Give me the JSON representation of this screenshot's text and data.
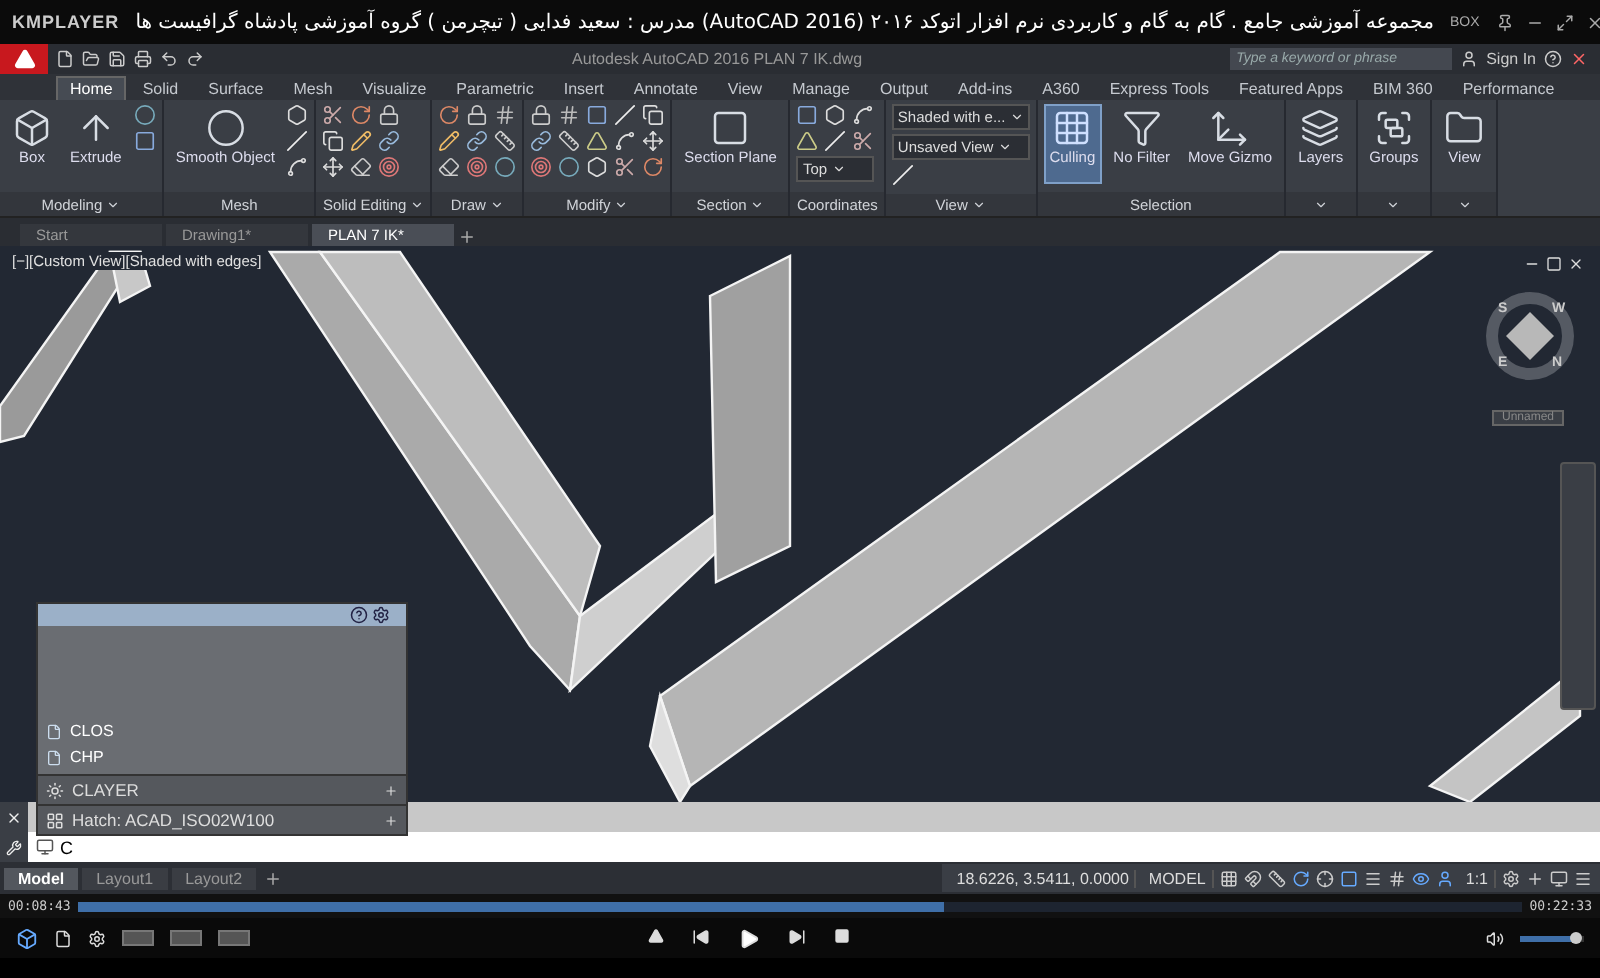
{
  "player": {
    "brand": "KMPLAYER",
    "title": "مجموعه آموزشی جامع . گام به گام و کاربردی نرم افزار  اتوکد ۲۰۱۶ (AutoCAD 2016)  مدرس : سعید فدایی ( تیچرمن ) گروه آموزشی پادشاه گرافیست ها",
    "box_label": "BOX"
  },
  "autocad": {
    "doc_title": "Autodesk AutoCAD 2016    PLAN 7 IK.dwg",
    "search_placeholder": "Type a keyword or phrase",
    "sign_in": "Sign In",
    "ribbon_tabs": [
      {
        "label": "Home",
        "selected": true
      },
      {
        "label": "Solid",
        "selected": false
      },
      {
        "label": "Surface",
        "selected": false
      },
      {
        "label": "Mesh",
        "selected": false
      },
      {
        "label": "Visualize",
        "selected": false
      },
      {
        "label": "Parametric",
        "selected": false
      },
      {
        "label": "Insert",
        "selected": false
      },
      {
        "label": "Annotate",
        "selected": false
      },
      {
        "label": "View",
        "selected": false
      },
      {
        "label": "Manage",
        "selected": false
      },
      {
        "label": "Output",
        "selected": false
      },
      {
        "label": "Add-ins",
        "selected": false
      },
      {
        "label": "A360",
        "selected": false
      },
      {
        "label": "Express Tools",
        "selected": false
      },
      {
        "label": "Featured Apps",
        "selected": false
      },
      {
        "label": "BIM 360",
        "selected": false
      },
      {
        "label": "Performance",
        "selected": false
      }
    ],
    "panels": [
      {
        "label": "Modeling",
        "menu": true,
        "tools": [
          {
            "kind": "large",
            "label": "Box",
            "active": false
          },
          {
            "kind": "large",
            "label": "Extrude",
            "active": false
          },
          {
            "kind": "small"
          },
          {
            "kind": "small"
          }
        ]
      },
      {
        "label": "Mesh",
        "menu": false,
        "tools": [
          {
            "kind": "large",
            "label": "Smooth Object",
            "active": false
          },
          {
            "kind": "small"
          },
          {
            "kind": "small"
          },
          {
            "kind": "small"
          }
        ]
      },
      {
        "label": "Solid Editing",
        "menu": true,
        "tools": [
          {
            "kind": "small"
          },
          {
            "kind": "small"
          },
          {
            "kind": "small"
          },
          {
            "kind": "small"
          },
          {
            "kind": "small"
          },
          {
            "kind": "small"
          },
          {
            "kind": "small"
          },
          {
            "kind": "small"
          },
          {
            "kind": "small"
          }
        ]
      },
      {
        "label": "Draw",
        "menu": true,
        "tools": [
          {
            "kind": "small"
          },
          {
            "kind": "small"
          },
          {
            "kind": "small"
          },
          {
            "kind": "small"
          },
          {
            "kind": "small"
          },
          {
            "kind": "small"
          },
          {
            "kind": "small"
          },
          {
            "kind": "small"
          },
          {
            "kind": "small"
          }
        ]
      },
      {
        "label": "Modify",
        "menu": true,
        "tools": [
          {
            "kind": "small"
          },
          {
            "kind": "small"
          },
          {
            "kind": "small"
          },
          {
            "kind": "small"
          },
          {
            "kind": "small"
          },
          {
            "kind": "small"
          },
          {
            "kind": "small"
          },
          {
            "kind": "small"
          },
          {
            "kind": "small"
          },
          {
            "kind": "small"
          },
          {
            "kind": "small"
          },
          {
            "kind": "small"
          },
          {
            "kind": "small"
          },
          {
            "kind": "small"
          },
          {
            "kind": "small"
          }
        ]
      },
      {
        "label": "Section",
        "menu": true,
        "tools": [
          {
            "kind": "large",
            "label": "Section Plane",
            "active": false
          }
        ]
      },
      {
        "label": "Coordinates",
        "menu": false,
        "tools": [
          {
            "kind": "small"
          },
          {
            "kind": "small"
          },
          {
            "kind": "small"
          },
          {
            "kind": "small"
          },
          {
            "kind": "small"
          },
          {
            "kind": "small"
          },
          {
            "kind": "combo",
            "label": "Top"
          }
        ]
      },
      {
        "label": "View",
        "menu": true,
        "tools": [
          {
            "kind": "combo",
            "label": "Shaded with e..."
          },
          {
            "kind": "combo",
            "label": "Unsaved View"
          },
          {
            "kind": "small"
          }
        ]
      },
      {
        "label": "Selection",
        "menu": false,
        "tools": [
          {
            "kind": "large",
            "label": "Culling",
            "active": true
          },
          {
            "kind": "large",
            "label": "No Filter",
            "active": false
          },
          {
            "kind": "large",
            "label": "Move Gizmo",
            "active": false
          }
        ]
      },
      {
        "menu": true,
        "tools": [
          {
            "kind": "large",
            "label": "Layers",
            "active": false
          }
        ]
      },
      {
        "menu": true,
        "tools": [
          {
            "kind": "large",
            "label": "Groups",
            "active": false
          }
        ]
      },
      {
        "menu": true,
        "tools": [
          {
            "kind": "large",
            "label": "View",
            "active": false
          }
        ]
      }
    ],
    "file_tabs": [
      {
        "label": "Start",
        "selected": false
      },
      {
        "label": "Drawing1*",
        "selected": false
      },
      {
        "label": "PLAN 7 IK*",
        "selected": true
      }
    ],
    "viewport_label": "[−][Custom View][Shaded with edges]",
    "compass": [
      "S",
      "W",
      "E",
      "N"
    ],
    "view_name": "Unnamed",
    "history": [
      "CLOS",
      "CHP"
    ],
    "palette_rows": [
      "CLAYER",
      "Hatch: ACAD_ISO02W100"
    ],
    "command_input": "C",
    "layout_tabs": [
      {
        "label": "Model",
        "selected": true
      },
      {
        "label": "Layout1",
        "selected": false
      },
      {
        "label": "Layout2",
        "selected": false
      }
    ],
    "status": {
      "coords": "18.6226, 3.5411, 0.0000",
      "space": "MODEL",
      "scale": "1:1"
    }
  },
  "playback": {
    "current_time": "00:08:43",
    "total_time": "00:22:33",
    "level": 0.6
  },
  "volume": {
    "level": 0.88
  }
}
